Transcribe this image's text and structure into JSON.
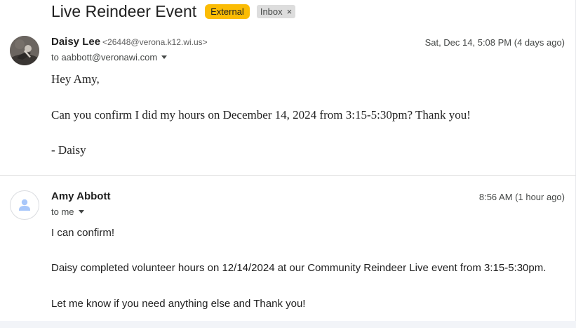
{
  "subject": "Live Reindeer Event",
  "labels": {
    "external": "External",
    "inbox": "Inbox",
    "remove": "×"
  },
  "messages": [
    {
      "sender_name": "Daisy Lee",
      "sender_email": "<26448@verona.k12.wi.us>",
      "recipient": "to aabbott@veronawi.com",
      "date": "Sat, Dec 14, 5:08 PM (4 days ago)",
      "body": [
        "Hey Amy,",
        "Can you confirm I did my hours on December 14, 2024 from 3:15-5:30pm? Thank you!",
        "- Daisy"
      ]
    },
    {
      "sender_name": "Amy Abbott",
      "recipient": "to me",
      "date": "8:56 AM (1 hour ago)",
      "body": [
        "I can confirm!",
        "Daisy completed volunteer hours on 12/14/2024 at our Community Reindeer Live event from 3:15-5:30pm.",
        "Let me know if you need anything else and Thank you!"
      ]
    }
  ],
  "icons": {
    "avatar_photo": "profile-photo",
    "avatar_default": "default-person-icon",
    "recipient_menu": "chevron-down-icon",
    "remove_label": "close-icon"
  },
  "colors": {
    "external_badge": "#fbbc04",
    "inbox_badge": "#dddddd",
    "default_avatar_icon": "#a8c7fa"
  }
}
